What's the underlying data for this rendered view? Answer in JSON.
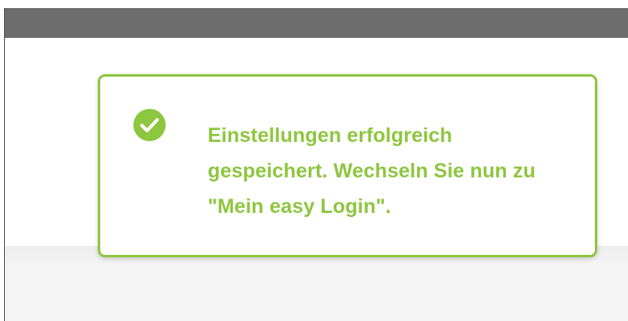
{
  "notification": {
    "type": "success",
    "icon": "check-circle-icon",
    "message": "Einstellungen erfolgreich gespeichert. Wechseln Sie nun zu \"Mein easy Login\".",
    "accent_color": "#8dc63f"
  },
  "colors": {
    "header_bar": "#6d6d6d",
    "background": "#ffffff",
    "footer_area": "#f5f5f5"
  }
}
